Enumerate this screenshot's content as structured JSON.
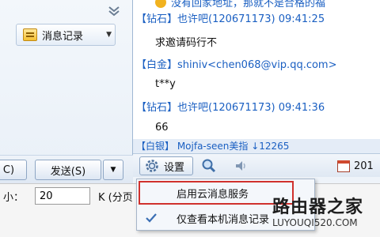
{
  "left": {
    "msg_record_label": "消息记录",
    "close_label": "C)",
    "send_label": "发送(S)"
  },
  "chat": {
    "top_partial": "没有回家地址，那就不是合格的福",
    "messages": [
      {
        "sender": "【钻石】也许吧(120671173) 09:41:25",
        "text": "求邀请码行不"
      },
      {
        "sender": "【白金】shiniv<chen068@vip.qq.com>",
        "text": "t**y"
      },
      {
        "sender": "【钻石】也许吧(120671173) 09:41:36",
        "text": "66"
      }
    ],
    "partial_bottom": "【白银】 Mojfa-seen美指 ↓12265"
  },
  "toolbar": {
    "settings_label": "设置",
    "calendar_label": "201"
  },
  "fontbar": {
    "size_label": "小：",
    "size_value": "20",
    "unit_label": "K (分页"
  },
  "menu": {
    "items": [
      {
        "label": "启用云消息服务",
        "checked": false,
        "highlighted": true
      },
      {
        "label": "仅查看本机消息记录",
        "checked": true,
        "highlighted": false
      }
    ],
    "highlight_color": "#d0312d"
  },
  "watermark": {
    "title": "路由器之家",
    "url": "LUYOUQI520.COM"
  },
  "colors": {
    "sender": "#1a5fc2",
    "accent": "#1a5fc2"
  }
}
